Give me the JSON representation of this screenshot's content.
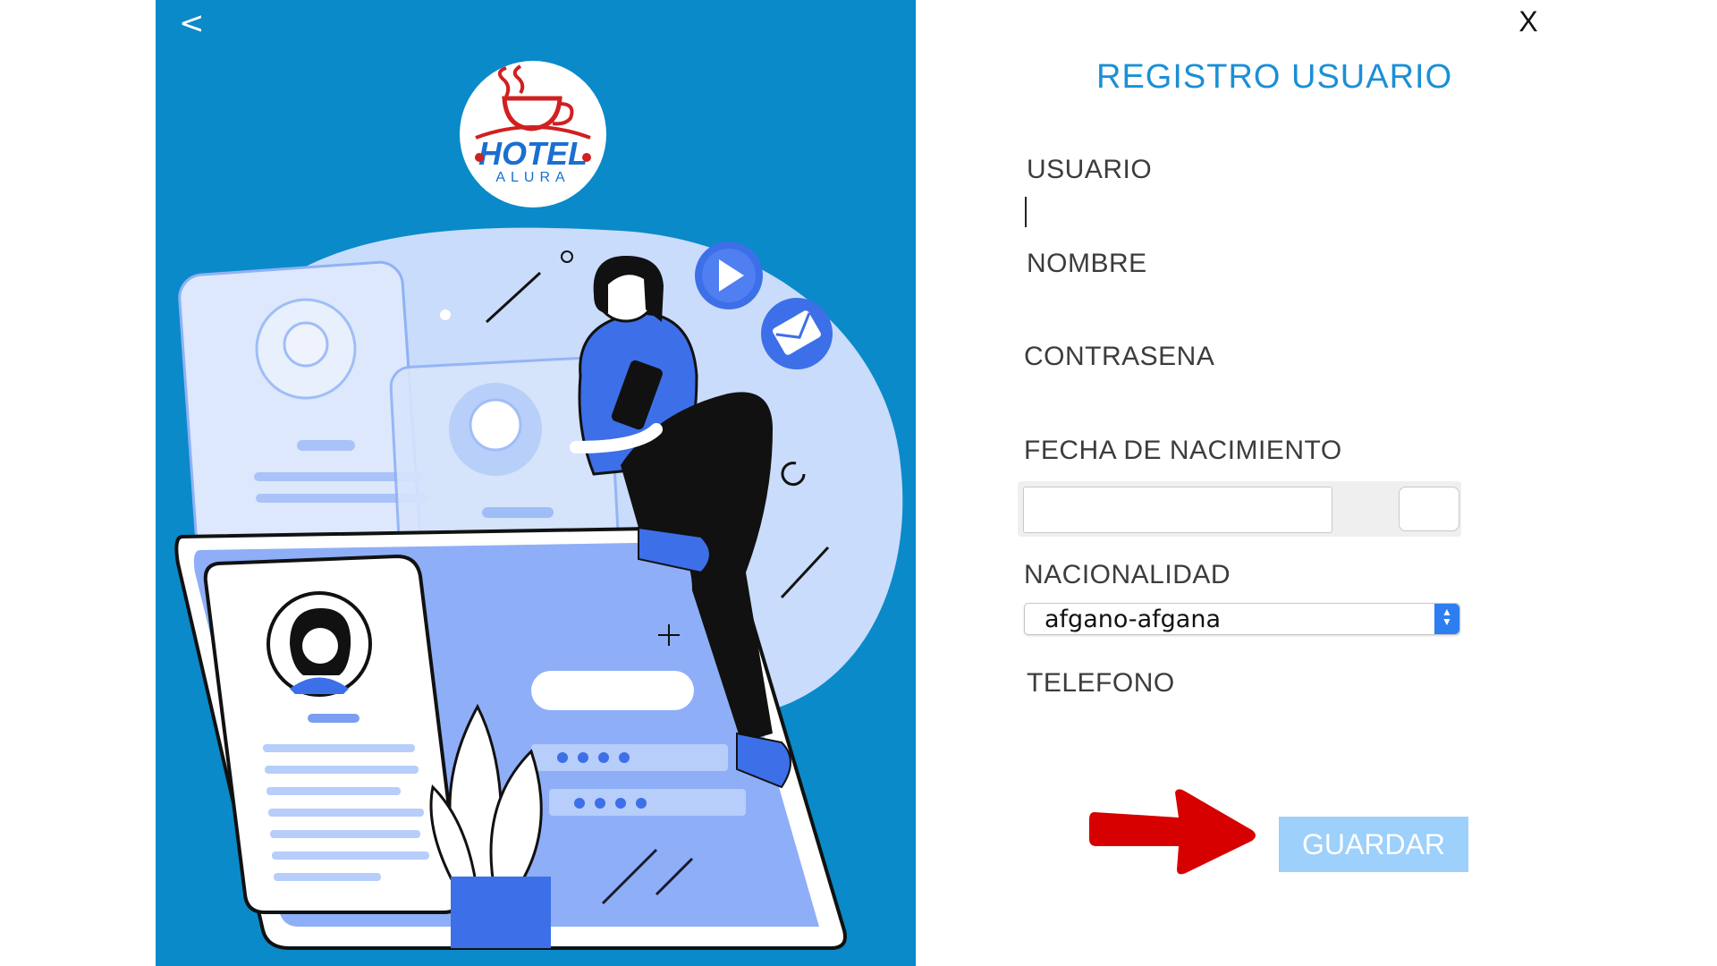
{
  "window": {
    "back_label": "<",
    "close_label": "X"
  },
  "branding": {
    "logo_text_main": "HOTEL",
    "logo_text_sub": "ALURA"
  },
  "form": {
    "title": "REGISTRO USUARIO",
    "fields": {
      "usuario_label": "USUARIO",
      "usuario_value": "",
      "nombre_label": "NOMBRE",
      "nombre_value": "",
      "contrasena_label": "CONTRASENA",
      "contrasena_value": "",
      "fecha_label": "FECHA DE NACIMIENTO",
      "fecha_value": "",
      "nacionalidad_label": "NACIONALIDAD",
      "nacionalidad_value": "afgano-afgana",
      "telefono_label": "TELEFONO",
      "telefono_value": ""
    },
    "save_label": "GUARDAR"
  },
  "icons": {
    "back": "chevron-left-icon",
    "close": "close-icon",
    "calendar": "calendar-icon",
    "select": "select-arrows-icon",
    "annotation": "red-arrow-icon"
  },
  "colors": {
    "panel_blue": "#0a8ac9",
    "title_blue": "#1a8fd6",
    "button_blue": "#9dd0fb",
    "arrow_red": "#d70000",
    "select_accent": "#2d7ef0"
  }
}
